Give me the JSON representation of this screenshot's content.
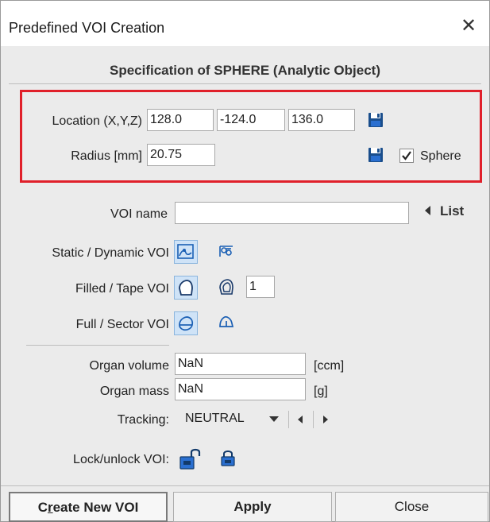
{
  "window": {
    "title": "Predefined VOI Creation",
    "close_glyph": "✕"
  },
  "heading": "Specification of SPHERE (Analytic Object)",
  "location": {
    "label": "Location (X,Y,Z)",
    "x": "128.0",
    "y": "-124.0",
    "z": "136.0",
    "save_icon": "floppy-disk-icon"
  },
  "radius": {
    "label": "Radius [mm]",
    "value": "20.75",
    "save_icon": "floppy-disk-icon",
    "sphere_label": "Sphere",
    "sphere_checked": true
  },
  "voi_name": {
    "label": "VOI name",
    "value": "",
    "list_label": "List"
  },
  "static_dynamic": {
    "label": "Static / Dynamic VOI",
    "static_icon": "static-voi-icon",
    "dynamic_icon": "dynamic-voi-icon",
    "selected": "static"
  },
  "filled_tape": {
    "label": "Filled / Tape VOI",
    "filled_icon": "filled-voi-icon",
    "tape_icon": "tape-voi-icon",
    "tape_width": "1",
    "selected": "filled"
  },
  "full_sector": {
    "label": "Full / Sector VOI",
    "full_icon": "full-voi-icon",
    "sector_icon": "sector-voi-icon",
    "selected": "full"
  },
  "organ_volume": {
    "label": "Organ volume",
    "value": "NaN",
    "unit": "[ccm]"
  },
  "organ_mass": {
    "label": "Organ mass",
    "value": "NaN",
    "unit": "[g]"
  },
  "tracking": {
    "label": "Tracking:",
    "value": "NEUTRAL"
  },
  "lock": {
    "label": "Lock/unlock VOI:",
    "unlock_icon": "unlock-icon",
    "lock_icon": "lock-icon"
  },
  "buttons": {
    "create": "Create New VOI",
    "apply": "Apply",
    "close": "Close"
  },
  "colors": {
    "highlight_box": "#e0202a",
    "selected_tool_bg": "#cfe3f7",
    "icon_blue": "#1a5fb4"
  }
}
